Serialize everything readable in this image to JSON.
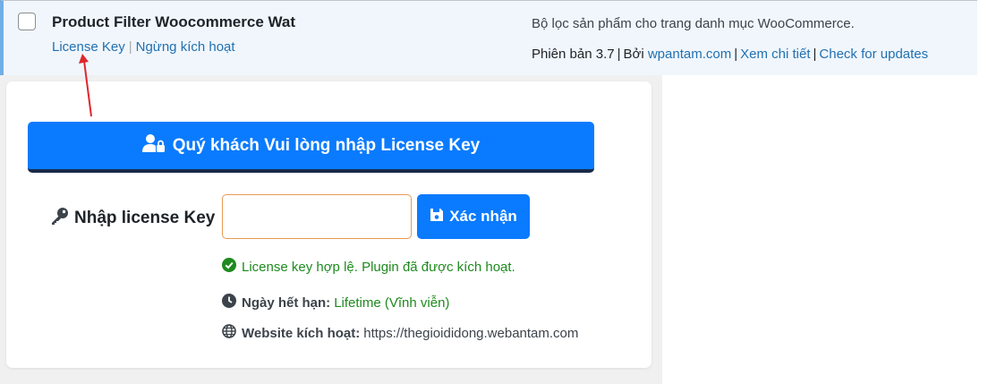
{
  "plugin": {
    "title": "Product Filter Woocommerce Wat",
    "actions": {
      "license_key": "License Key",
      "deactivate": "Ngừng kích hoạt",
      "separator": "|"
    },
    "description": "Bộ lọc sản phẩm cho trang danh mục WooCommerce.",
    "meta": {
      "version": "Phiên bản 3.7",
      "by": "Bởi",
      "author": "wpantam.com",
      "details": "Xem chi tiết",
      "updates": "Check for updates",
      "separator": "|"
    }
  },
  "license_panel": {
    "banner": "Quý khách Vui lòng nhập License Key",
    "input_label": "Nhập license Key",
    "input_value": "",
    "confirm_button": "Xác nhận",
    "status": "License key hợp lệ. Plugin đã được kích hoạt.",
    "expiry_label": "Ngày hết hạn:",
    "expiry_value": "Lifetime (Vĩnh viễn)",
    "website_label": "Website kích hoạt:",
    "website_value": "https://thegioididong.webantam.com"
  },
  "colors": {
    "accent": "#0a7bff",
    "success": "#1e8a1e",
    "link": "#2271b1",
    "row_bg": "#f0f6fc",
    "annotation": "#e0262b"
  }
}
